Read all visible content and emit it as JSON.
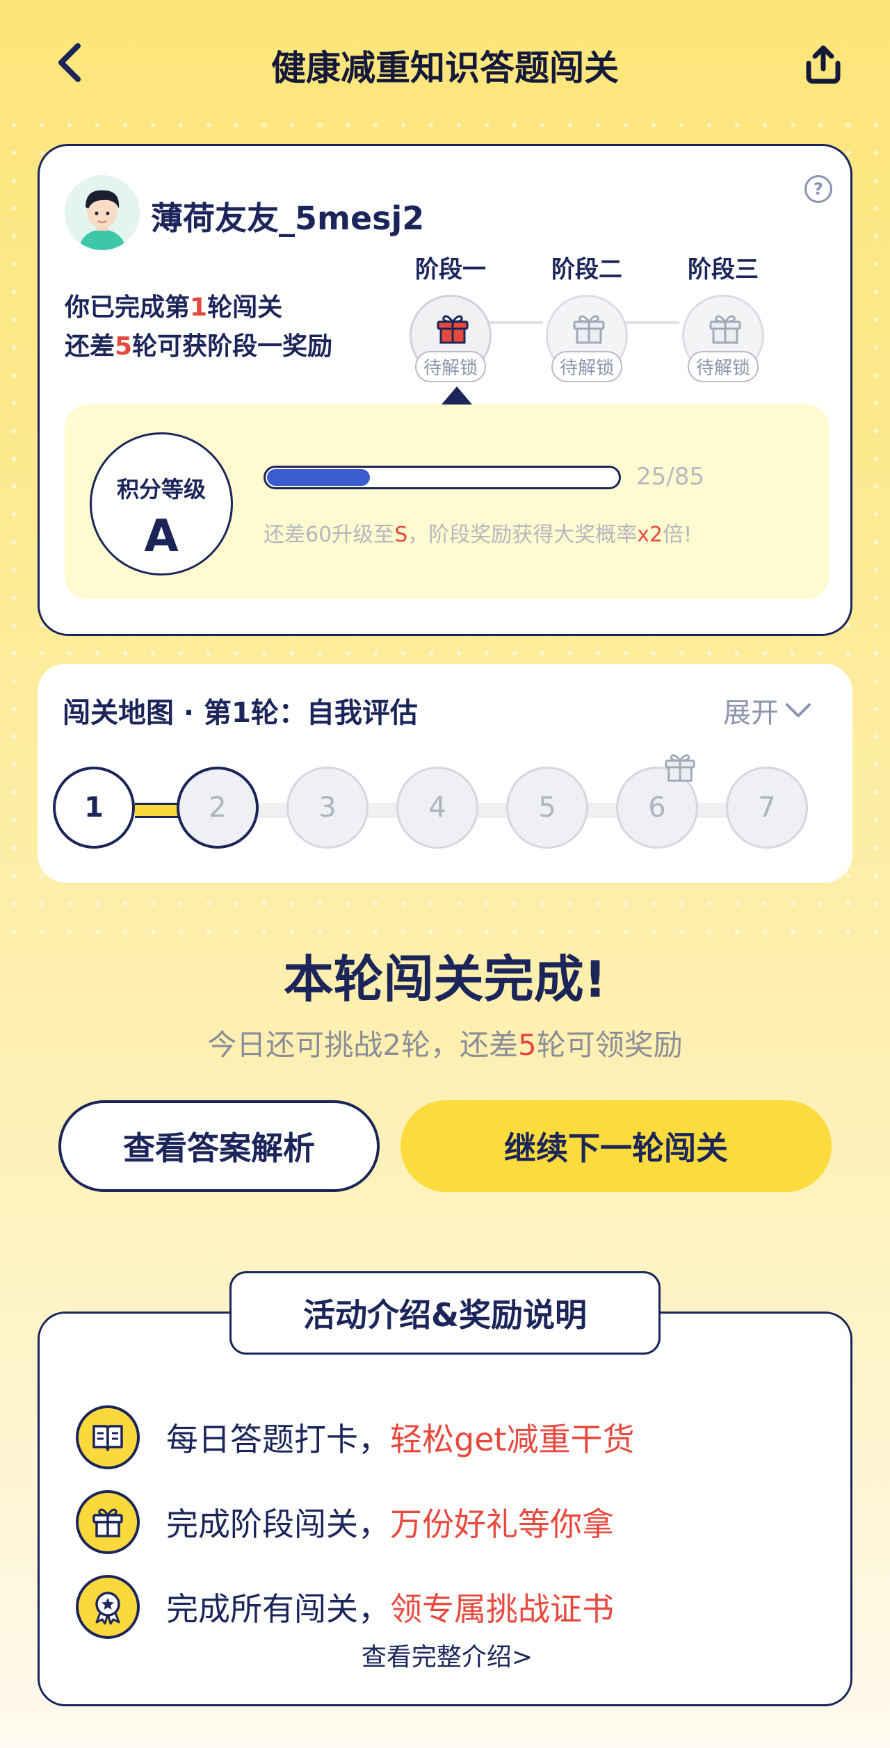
{
  "header": {
    "title": "健康减重知识答题闯关",
    "back_icon": "chevron-left-icon",
    "share_icon": "share-upload-icon"
  },
  "user": {
    "name": "薄荷友友_5mesj2",
    "line1_prefix": "你已完成第",
    "line1_num": "1",
    "line1_suffix": "轮闯关",
    "line2_prefix": "还差",
    "line2_num": "5",
    "line2_suffix": "轮可获阶段一奖励"
  },
  "stages": [
    {
      "label": "阶段一",
      "tag": "待解锁"
    },
    {
      "label": "阶段二",
      "tag": "待解锁"
    },
    {
      "label": "阶段三",
      "tag": "待解锁"
    }
  ],
  "score": {
    "label": "积分等级",
    "grade": "A",
    "current": 25,
    "total": 85,
    "count_text": "25/85",
    "note_prefix": "还差60升级至",
    "note_grade": "S",
    "note_mid": "，阶段奖励获得大奖概率",
    "note_mult": "x2",
    "note_suffix": "倍!"
  },
  "map": {
    "title": "闯关地图 · 第1轮：自我评估",
    "expand": "展开",
    "levels": [
      "1",
      "2",
      "3",
      "4",
      "5",
      "6",
      "7"
    ]
  },
  "completion": {
    "title": "本轮闯关完成!",
    "sub_prefix": "今日还可挑战2轮，还差",
    "sub_num": "5",
    "sub_suffix": "轮可领奖励"
  },
  "buttons": {
    "answers": "查看答案解析",
    "next": "继续下一轮闯关"
  },
  "intro": {
    "title": "活动介绍&奖励说明",
    "features": [
      {
        "icon": "book-icon",
        "text": "每日答题打卡，",
        "highlight": "轻松get减重干货"
      },
      {
        "icon": "gift-icon",
        "text": "完成阶段闯关，",
        "highlight": "万份好礼等你拿"
      },
      {
        "icon": "medal-icon",
        "text": "完成所有闯关，",
        "highlight": "领专属挑战证书"
      }
    ],
    "link": "查看完整介绍>"
  },
  "colors": {
    "navy": "#1b2559",
    "yellow": "#fbdc3c",
    "red": "#e8493f",
    "bar_blue": "#3b5bd0"
  }
}
